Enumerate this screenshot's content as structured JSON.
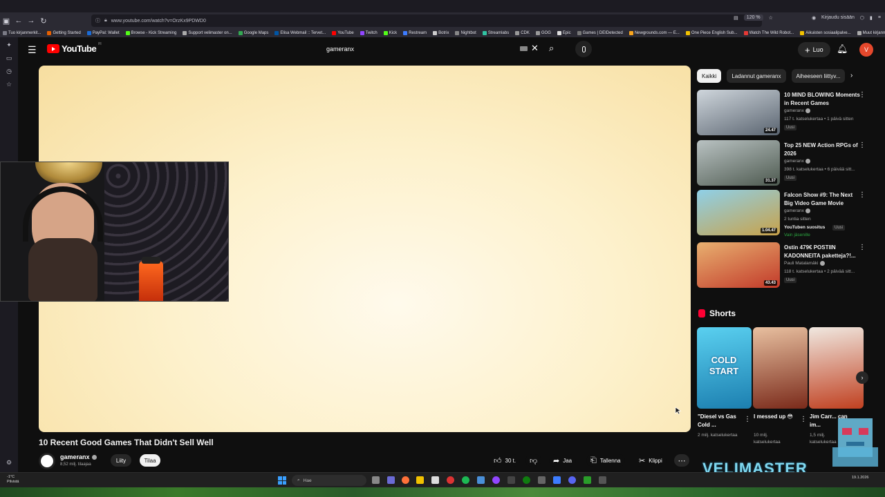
{
  "browser": {
    "url": "www.youtube.com/watch?v=OrzKx9PDWD0",
    "zoom": "120 %",
    "signin": "Kirjaudu sisään",
    "bookmarks": [
      {
        "label": "Tuo kirjanmerkit...",
        "color": "#7a7a85"
      },
      {
        "label": "Getting Started",
        "color": "#e66000"
      },
      {
        "label": "PayPal: Wallet",
        "color": "#1a6bd6"
      },
      {
        "label": "Browse - Kick Streaming",
        "color": "#53fc18"
      },
      {
        "label": "Support velimaster on...",
        "color": "#aaaaaa"
      },
      {
        "label": "Google Maps",
        "color": "#34a853"
      },
      {
        "label": "Elisa Webmail :: Tervet...",
        "color": "#0055a5"
      },
      {
        "label": "YouTube",
        "color": "#ff0000"
      },
      {
        "label": "Twitch",
        "color": "#9146ff"
      },
      {
        "label": "Kick",
        "color": "#53fc18"
      },
      {
        "label": "Restream",
        "color": "#3d7dff"
      },
      {
        "label": "Botrix",
        "color": "#cccccc"
      },
      {
        "label": "Nightbot",
        "color": "#888888"
      },
      {
        "label": "Streamlabs",
        "color": "#31c3a2"
      },
      {
        "label": "CDK",
        "color": "#999999"
      },
      {
        "label": "GOG",
        "color": "#999999"
      },
      {
        "label": "Epic",
        "color": "#dddddd"
      },
      {
        "label": "Games | DEIDetected",
        "color": "#777777"
      },
      {
        "label": "Newgrounds.com — E...",
        "color": "#f8a51e"
      },
      {
        "label": "One Piece English Sub...",
        "color": "#f2c200"
      },
      {
        "label": "Watch The Wild Robot...",
        "color": "#e53935"
      },
      {
        "label": "Aikuisten sosiaalipalve...",
        "color": "#f2c200"
      },
      {
        "label": "Muut kirjanmerkit",
        "color": "#aaaaaa"
      }
    ]
  },
  "youtube": {
    "logo_text": "YouTube",
    "logo_region": "FI",
    "search_value": "gameranx",
    "create_label": "Luo",
    "avatar_letter": "V"
  },
  "video": {
    "title": "10 Recent Good Games That Didn't Sell Well",
    "channel": "gameranx",
    "subscribers": "8,52 milj. tilaajaa",
    "join_label": "Liity",
    "subscribe_label": "Tilaa",
    "likes": "30 t.",
    "share_label": "Jaa",
    "save_label": "Tallenna",
    "clip_label": "Klippi"
  },
  "chips": [
    "Kaikki",
    "Ladannut gameranx",
    "Aiheeseen liittyv..."
  ],
  "recommendations": [
    {
      "title": "10 MIND BLOWING Moments in Recent Games",
      "channel": "gameranx",
      "meta": "117 t. katselukertaa • 1 päivä sitten",
      "badge": "Uusi",
      "duration": "24.47",
      "thumb_colors": [
        "#cfd6dc",
        "#5a6470"
      ]
    },
    {
      "title": "Top 25 NEW Action RPGs of 2026",
      "channel": "gameranx",
      "meta": "398 t. katselukertaa • 6 päivää sitt...",
      "badge": "Uusi",
      "duration": "31.37",
      "thumb_colors": [
        "#b9c2c2",
        "#4e5a50"
      ]
    },
    {
      "title": "Falcon Show #9: The Next Big Video Game Movie",
      "channel": "gameranx",
      "meta": "2 tuntia sitten",
      "meta2": "YouTuben suositus",
      "badge": "Uusi",
      "members": "Vain jäsenille",
      "duration": "1.04.47",
      "thumb_colors": [
        "#8fd0e8",
        "#c8a24a"
      ]
    },
    {
      "title": "Ostin 479€ POSTIIN KADONNEITA paketteja?!...",
      "channel": "Pauli Matalamäki",
      "meta": "118 t. katselukertaa • 2 päivää sitt...",
      "badge": "Uusi",
      "duration": "43.43",
      "thumb_colors": [
        "#e8b070",
        "#c23a2a"
      ]
    }
  ],
  "shorts": {
    "heading": "Shorts",
    "items": [
      {
        "title": "\"Diesel vs Gas Cold ...",
        "meta": "2 milj. katselukertaa",
        "thumb_colors": [
          "#5ad0f0",
          "#1c7fb0"
        ],
        "overlay": "COLD START"
      },
      {
        "title": "I messed up 😳",
        "meta": "10 milj. katselukertaa",
        "thumb_colors": [
          "#e8c0a0",
          "#7a2a1a"
        ],
        "overlay": ""
      },
      {
        "title": "Jim Carr... can im...",
        "meta": "1,5 milj. katselukertaa",
        "thumb_colors": [
          "#f0e8e0",
          "#c04020"
        ],
        "overlay": ""
      }
    ]
  },
  "overlay": {
    "watermark": "VELIMASTER"
  },
  "taskbar": {
    "weather_temp": "-1°C",
    "weather_desc": "Pilvistä",
    "search_label": "Hae",
    "date": "19.1.2026"
  }
}
